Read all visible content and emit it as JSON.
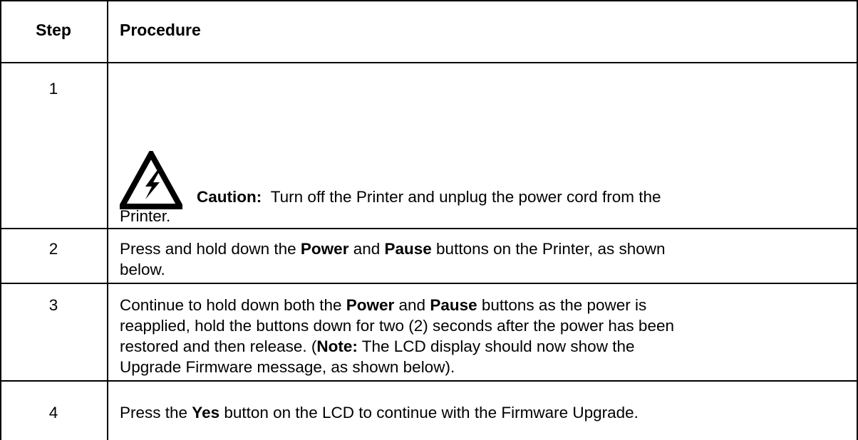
{
  "table": {
    "headers": {
      "step": "Step",
      "procedure": "Procedure"
    },
    "rows": [
      {
        "step": "1",
        "icon": "high-voltage-warning-icon",
        "caution_label": "Caution:",
        "caution_text_line1": "Turn off the Printer and unplug the power cord from the",
        "caution_text_line2": "Printer."
      },
      {
        "step": "2",
        "p1": "Press and hold down the ",
        "b1": "Power",
        "p2": " and ",
        "b2": "Pause",
        "p3": " buttons on the Printer, as shown",
        "line2": "below."
      },
      {
        "step": "3",
        "l1_a": "Continue to hold down both the ",
        "l1_b1": "Power",
        "l1_c": " and ",
        "l1_b2": "Pause",
        "l1_d": " buttons as the power is",
        "l2": "reapplied, hold the buttons down for two (2) seconds after the power has been",
        "l3_a": "restored and then release. (",
        "l3_b": "Note:",
        "l3_c": " The LCD display should now show the",
        "l4": "Upgrade Firmware message, as shown below)."
      },
      {
        "step": "4",
        "p1": "Press the ",
        "b1": "Yes",
        "p2": " button on the LCD to continue with the Firmware Upgrade."
      }
    ]
  }
}
